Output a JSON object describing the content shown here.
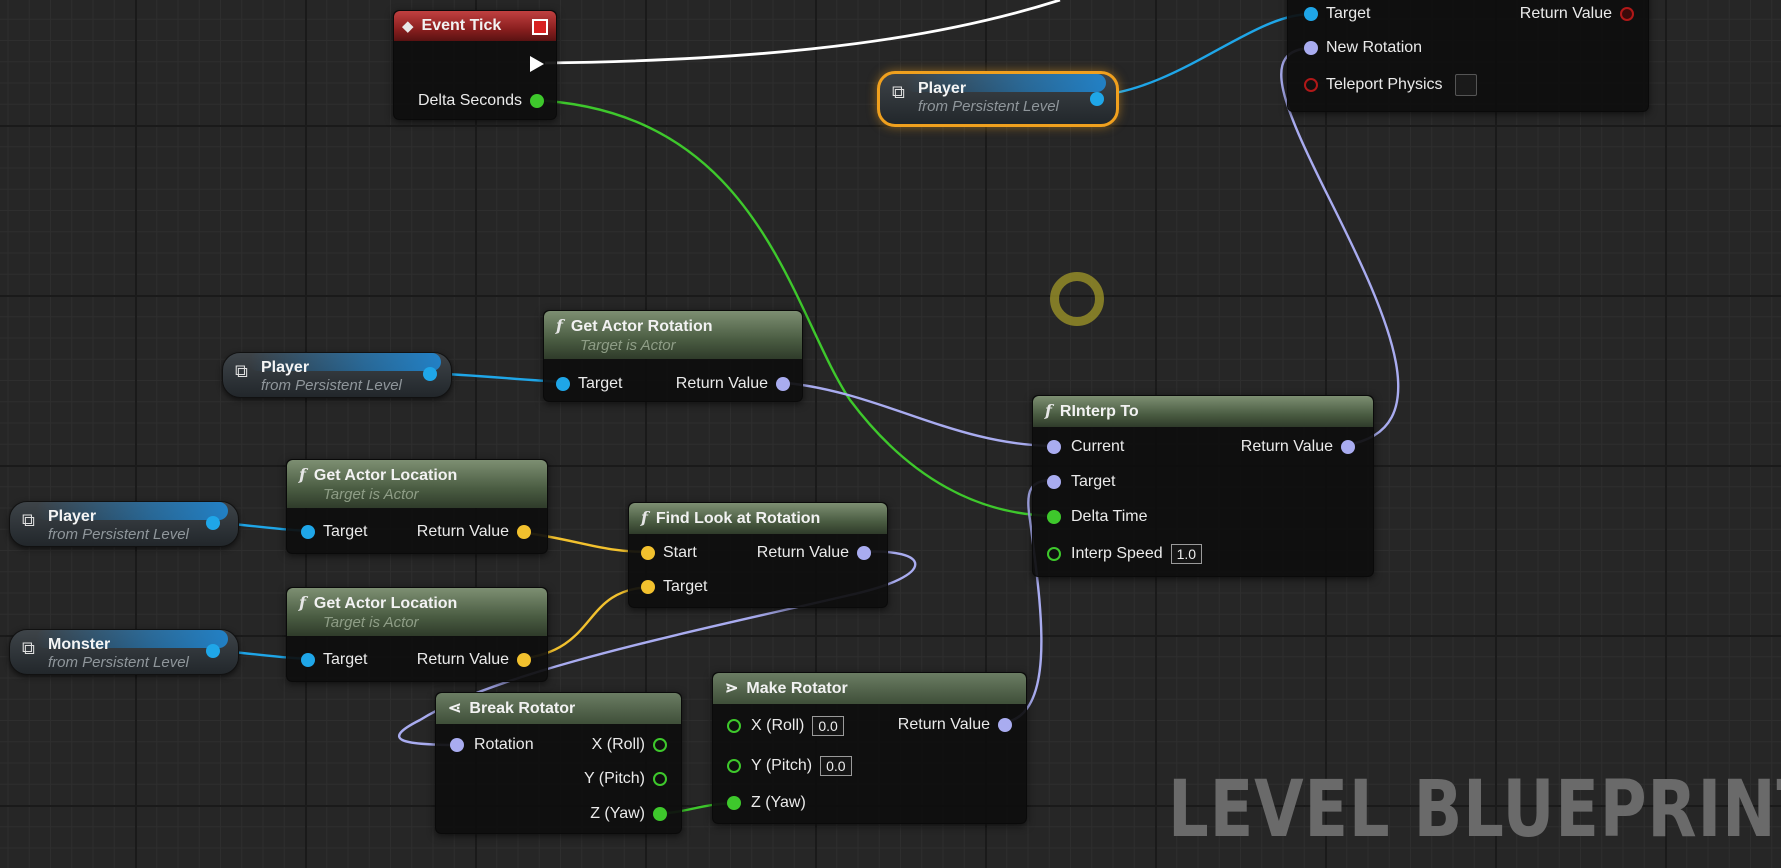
{
  "watermark": "LEVEL BLUEPRINT",
  "event_tick": {
    "title": "Event Tick",
    "delta": "Delta Seconds"
  },
  "set_rotation": {
    "target": "Target",
    "return": "Return Value",
    "new_rotation": "New Rotation",
    "teleport": "Teleport Physics"
  },
  "player_getters": [
    {
      "title": "Player",
      "sub": "from Persistent Level"
    },
    {
      "title": "Player",
      "sub": "from Persistent Level"
    },
    {
      "title": "Player",
      "sub": "from Persistent Level"
    }
  ],
  "monster_getter": {
    "title": "Monster",
    "sub": "from Persistent Level"
  },
  "get_actor_rotation": {
    "title": "Get Actor Rotation",
    "sub": "Target is Actor",
    "target": "Target",
    "return": "Return Value"
  },
  "get_actor_location_1": {
    "title": "Get Actor Location",
    "sub": "Target is Actor",
    "target": "Target",
    "return": "Return Value"
  },
  "get_actor_location_2": {
    "title": "Get Actor Location",
    "sub": "Target is Actor",
    "target": "Target",
    "return": "Return Value"
  },
  "find_look": {
    "title": "Find Look at Rotation",
    "start": "Start",
    "target": "Target",
    "return": "Return Value"
  },
  "rinterp": {
    "title": "RInterp To",
    "current": "Current",
    "target": "Target",
    "delta": "Delta Time",
    "speed": "Interp Speed",
    "speed_value": "1.0",
    "return": "Return Value"
  },
  "break_rot": {
    "title": "Break Rotator",
    "rotation": "Rotation",
    "x": "X (Roll)",
    "y": "Y (Pitch)",
    "z": "Z (Yaw)"
  },
  "make_rot": {
    "title": "Make Rotator",
    "x": "X (Roll)",
    "x_val": "0.0",
    "y": "Y (Pitch)",
    "y_val": "0.0",
    "z": "Z (Yaw)",
    "return": "Return Value"
  },
  "colors": {
    "exec": "#ffffff",
    "object": "#1fa6e8",
    "rotator": "#a9acf0",
    "float": "#3ec82c",
    "vector": "#f2c12e",
    "selected": "#f0a01e"
  }
}
